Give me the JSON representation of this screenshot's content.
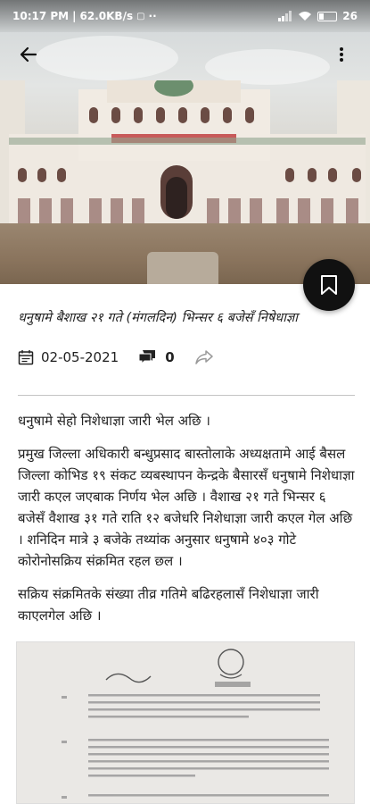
{
  "status_bar": {
    "time": "10:17 PM",
    "speed": "62.0KB/s",
    "battery": "26"
  },
  "article": {
    "title": "धनुषामे बैशाख २१ गते (मंगलदिन) भिन्सर ६ बजेसँ निषेधाज्ञा",
    "date": "02-05-2021",
    "comment_count": "0",
    "paragraphs": [
      "धनुषामे सेहो निशेधाज्ञा जारी भेल अछि ।",
      "प्रमुख जिल्ला अधिकारी बन्धुप्रसाद बास्तोलाके अध्यक्षतामे आई बैसल जिल्ला कोभिड १९ संकट व्यबस्थापन केन्द्रके बैसारसँ धनुषामे निशेधाज्ञा जारी कएल जएबाक निर्णय भेल अछि । वैशाख २१ गते भिन्सर ६ बजेसँ वैशाख ३१ गते राति १२ बजेधरि निशेधाज्ञा जारी कएल गेल अछि । शनिदिन मात्रे ३ बजेके तथ्यांक अनुसार धनुषामे ४०३ गोटे कोरोनोसक्रिय संक्रमित रहल छल ।",
      "सक्रिय संक्रमितके संख्या तीव्र गतिमे बढिरहलासँ निशेधाज्ञा जारी काएलगेल अछि ।"
    ]
  },
  "icons": {
    "back": "arrow-left-icon",
    "more": "more-vert-icon",
    "bookmark": "bookmark-icon",
    "calendar": "calendar-icon",
    "comment": "comment-icon",
    "share": "share-icon"
  },
  "colors": {
    "fab": "#111111",
    "divider": "#c4c4c4"
  }
}
